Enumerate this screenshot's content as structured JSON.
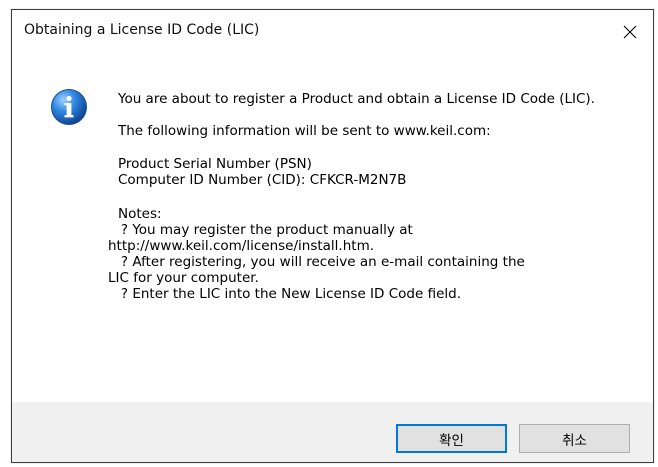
{
  "window": {
    "title": "Obtaining a License ID Code (LIC)"
  },
  "icons": {
    "info": "info-icon",
    "close": "close-icon"
  },
  "message": {
    "intro": "You are about to register a Product and obtain a License ID Code (LIC).",
    "sent_info": "The following information will be sent to www.keil.com:",
    "psn": "Product Serial Number (PSN)",
    "cid": "Computer ID Number (CID): CFKCR-M2N7B",
    "notes_header": "Notes:",
    "notes": [
      "   ? You may register the product manually at",
      "http://www.keil.com/license/install.htm.",
      "   ? After registering, you will receive an e-mail containing the",
      "LIC for your computer.",
      "   ? Enter the LIC into the New License ID Code field."
    ]
  },
  "buttons": {
    "ok_label": "확인",
    "cancel_label": "취소"
  },
  "colors": {
    "focus_border": "#0078d7",
    "footer_bg": "#f0f0f0",
    "button_bg": "#e1e1e1"
  }
}
